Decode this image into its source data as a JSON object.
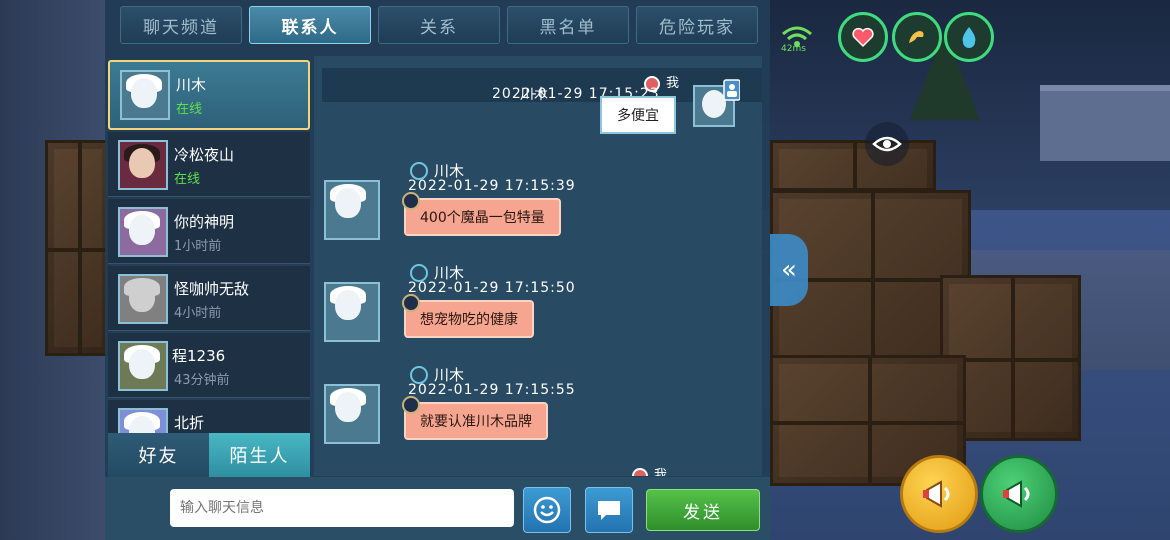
{
  "tabs": [
    {
      "label": "聊天频道",
      "active": false
    },
    {
      "label": "联系人",
      "active": true
    },
    {
      "label": "关系",
      "active": false
    },
    {
      "label": "黑名单",
      "active": false
    },
    {
      "label": "危险玩家",
      "active": false
    }
  ],
  "contacts": [
    {
      "name": "川木",
      "status": "在线",
      "online": true,
      "active": true
    },
    {
      "name": "冷松夜山",
      "status": "在线",
      "online": true,
      "active": false
    },
    {
      "name": "你的神明",
      "status": "1小时前",
      "online": false,
      "active": false
    },
    {
      "name": "怪咖帅无敌",
      "status": "4小时前",
      "online": false,
      "active": false
    },
    {
      "name": "程1236",
      "status": "43分钟前",
      "online": false,
      "active": false
    },
    {
      "name": "北折",
      "status": "",
      "online": false,
      "active": false
    }
  ],
  "bottom_tabs": [
    {
      "label": "好友",
      "active": false
    },
    {
      "label": "陌生人",
      "active": true
    }
  ],
  "conversation": {
    "mine_label": "我",
    "overlay_name": "川木",
    "first_time": "2022-01-29  17:15:23",
    "my_message": "多便宜",
    "messages": [
      {
        "sender": "川木",
        "time": "2022-01-29  17:15:39",
        "text": "400个魔晶一包特量"
      },
      {
        "sender": "川木",
        "time": "2022-01-29  17:15:50",
        "text": "想宠物吃的健康"
      },
      {
        "sender": "川木",
        "time": "2022-01-29  17:15:55",
        "text": "就要认准川木品牌"
      }
    ],
    "trailing_mine_label": "我"
  },
  "input": {
    "placeholder": "输入聊天信息",
    "value": ""
  },
  "send_label": "发送",
  "hud": {
    "ping": "42ms"
  },
  "colors": {
    "accent": "#3fdc7f",
    "bubble": "#f6a591",
    "online": "#5fe14a",
    "send": "#3aa436"
  }
}
